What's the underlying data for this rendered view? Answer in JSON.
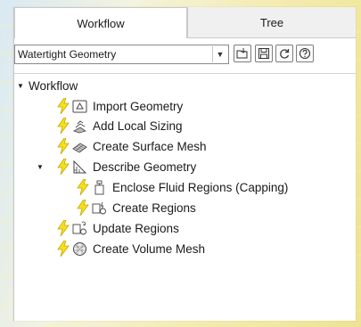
{
  "tabs": {
    "workflow": "Workflow",
    "tree": "Tree"
  },
  "toolbar": {
    "workflow_type": "Watertight Geometry",
    "buttons": [
      "load-icon",
      "save-icon",
      "refresh-icon",
      "help-icon"
    ]
  },
  "tree": {
    "root": "Workflow",
    "items": [
      {
        "label": "Import Geometry",
        "icon": "import-geometry-icon"
      },
      {
        "label": "Add Local Sizing",
        "icon": "local-sizing-icon"
      },
      {
        "label": "Create Surface Mesh",
        "icon": "surface-mesh-icon"
      },
      {
        "label": "Describe Geometry",
        "icon": "describe-geometry-icon"
      },
      {
        "label": "Enclose Fluid Regions (Capping)",
        "icon": "capping-icon"
      },
      {
        "label": "Create Regions",
        "icon": "create-regions-icon"
      },
      {
        "label": "Update Regions",
        "icon": "update-regions-icon"
      },
      {
        "label": "Create Volume Mesh",
        "icon": "volume-mesh-icon"
      }
    ]
  },
  "colors": {
    "bolt_fill": "#f7e11a",
    "bolt_stroke": "#c4a800",
    "tab_active_bg": "#ffffff",
    "tab_inactive_bg": "#f0f0f0"
  }
}
